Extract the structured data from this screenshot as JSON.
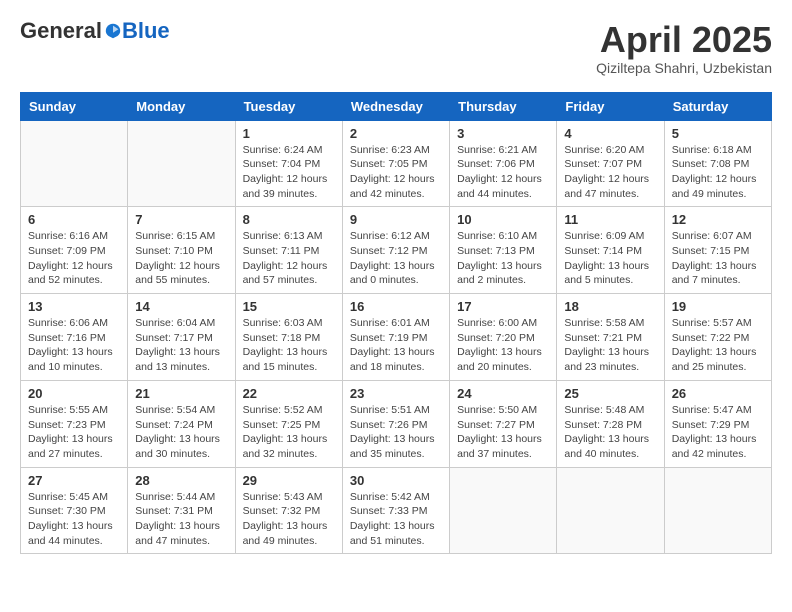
{
  "header": {
    "logo_general": "General",
    "logo_blue": "Blue",
    "month": "April 2025",
    "location": "Qiziltepa Shahri, Uzbekistan"
  },
  "weekdays": [
    "Sunday",
    "Monday",
    "Tuesday",
    "Wednesday",
    "Thursday",
    "Friday",
    "Saturday"
  ],
  "weeks": [
    [
      {
        "day": "",
        "info": ""
      },
      {
        "day": "",
        "info": ""
      },
      {
        "day": "1",
        "info": "Sunrise: 6:24 AM\nSunset: 7:04 PM\nDaylight: 12 hours and 39 minutes."
      },
      {
        "day": "2",
        "info": "Sunrise: 6:23 AM\nSunset: 7:05 PM\nDaylight: 12 hours and 42 minutes."
      },
      {
        "day": "3",
        "info": "Sunrise: 6:21 AM\nSunset: 7:06 PM\nDaylight: 12 hours and 44 minutes."
      },
      {
        "day": "4",
        "info": "Sunrise: 6:20 AM\nSunset: 7:07 PM\nDaylight: 12 hours and 47 minutes."
      },
      {
        "day": "5",
        "info": "Sunrise: 6:18 AM\nSunset: 7:08 PM\nDaylight: 12 hours and 49 minutes."
      }
    ],
    [
      {
        "day": "6",
        "info": "Sunrise: 6:16 AM\nSunset: 7:09 PM\nDaylight: 12 hours and 52 minutes."
      },
      {
        "day": "7",
        "info": "Sunrise: 6:15 AM\nSunset: 7:10 PM\nDaylight: 12 hours and 55 minutes."
      },
      {
        "day": "8",
        "info": "Sunrise: 6:13 AM\nSunset: 7:11 PM\nDaylight: 12 hours and 57 minutes."
      },
      {
        "day": "9",
        "info": "Sunrise: 6:12 AM\nSunset: 7:12 PM\nDaylight: 13 hours and 0 minutes."
      },
      {
        "day": "10",
        "info": "Sunrise: 6:10 AM\nSunset: 7:13 PM\nDaylight: 13 hours and 2 minutes."
      },
      {
        "day": "11",
        "info": "Sunrise: 6:09 AM\nSunset: 7:14 PM\nDaylight: 13 hours and 5 minutes."
      },
      {
        "day": "12",
        "info": "Sunrise: 6:07 AM\nSunset: 7:15 PM\nDaylight: 13 hours and 7 minutes."
      }
    ],
    [
      {
        "day": "13",
        "info": "Sunrise: 6:06 AM\nSunset: 7:16 PM\nDaylight: 13 hours and 10 minutes."
      },
      {
        "day": "14",
        "info": "Sunrise: 6:04 AM\nSunset: 7:17 PM\nDaylight: 13 hours and 13 minutes."
      },
      {
        "day": "15",
        "info": "Sunrise: 6:03 AM\nSunset: 7:18 PM\nDaylight: 13 hours and 15 minutes."
      },
      {
        "day": "16",
        "info": "Sunrise: 6:01 AM\nSunset: 7:19 PM\nDaylight: 13 hours and 18 minutes."
      },
      {
        "day": "17",
        "info": "Sunrise: 6:00 AM\nSunset: 7:20 PM\nDaylight: 13 hours and 20 minutes."
      },
      {
        "day": "18",
        "info": "Sunrise: 5:58 AM\nSunset: 7:21 PM\nDaylight: 13 hours and 23 minutes."
      },
      {
        "day": "19",
        "info": "Sunrise: 5:57 AM\nSunset: 7:22 PM\nDaylight: 13 hours and 25 minutes."
      }
    ],
    [
      {
        "day": "20",
        "info": "Sunrise: 5:55 AM\nSunset: 7:23 PM\nDaylight: 13 hours and 27 minutes."
      },
      {
        "day": "21",
        "info": "Sunrise: 5:54 AM\nSunset: 7:24 PM\nDaylight: 13 hours and 30 minutes."
      },
      {
        "day": "22",
        "info": "Sunrise: 5:52 AM\nSunset: 7:25 PM\nDaylight: 13 hours and 32 minutes."
      },
      {
        "day": "23",
        "info": "Sunrise: 5:51 AM\nSunset: 7:26 PM\nDaylight: 13 hours and 35 minutes."
      },
      {
        "day": "24",
        "info": "Sunrise: 5:50 AM\nSunset: 7:27 PM\nDaylight: 13 hours and 37 minutes."
      },
      {
        "day": "25",
        "info": "Sunrise: 5:48 AM\nSunset: 7:28 PM\nDaylight: 13 hours and 40 minutes."
      },
      {
        "day": "26",
        "info": "Sunrise: 5:47 AM\nSunset: 7:29 PM\nDaylight: 13 hours and 42 minutes."
      }
    ],
    [
      {
        "day": "27",
        "info": "Sunrise: 5:45 AM\nSunset: 7:30 PM\nDaylight: 13 hours and 44 minutes."
      },
      {
        "day": "28",
        "info": "Sunrise: 5:44 AM\nSunset: 7:31 PM\nDaylight: 13 hours and 47 minutes."
      },
      {
        "day": "29",
        "info": "Sunrise: 5:43 AM\nSunset: 7:32 PM\nDaylight: 13 hours and 49 minutes."
      },
      {
        "day": "30",
        "info": "Sunrise: 5:42 AM\nSunset: 7:33 PM\nDaylight: 13 hours and 51 minutes."
      },
      {
        "day": "",
        "info": ""
      },
      {
        "day": "",
        "info": ""
      },
      {
        "day": "",
        "info": ""
      }
    ]
  ]
}
